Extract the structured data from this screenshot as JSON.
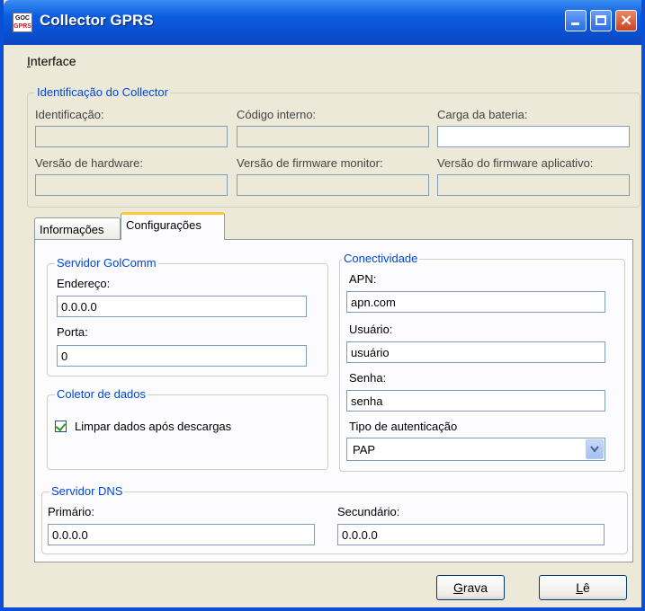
{
  "window": {
    "title": "Collector GPRS",
    "icon_text_top": "GOC",
    "icon_text_bottom": "GPRS",
    "controls": [
      "minimize-icon",
      "maximize-icon",
      "close-icon"
    ]
  },
  "menu": {
    "items": [
      {
        "first": "I",
        "rest": "nterface"
      }
    ]
  },
  "collector_group": {
    "legend": "Identificação do Collector",
    "fields": [
      {
        "label": "Identificação:",
        "value": ""
      },
      {
        "label": "Código interno:",
        "value": ""
      },
      {
        "label": "Carga da bateria:",
        "value": ""
      },
      {
        "label": "Versão de hardware:",
        "value": ""
      },
      {
        "label": "Versão de firmware monitor:",
        "value": ""
      },
      {
        "label": "Versão do firmware aplicativo:",
        "value": ""
      }
    ]
  },
  "tabs": {
    "items": [
      "Informações",
      "Configurações"
    ],
    "active": "Configurações"
  },
  "servidor_golcomm": {
    "legend": "Servidor GolComm",
    "endereco_label": "Endereço:",
    "endereco_value": "0.0.0.0",
    "porta_label": "Porta:",
    "porta_value": "0"
  },
  "coletor_de_dados": {
    "legend": "Coletor de dados",
    "checkbox_label": "Limpar dados após descargas",
    "checked": true
  },
  "conectividade": {
    "legend": "Conectividade",
    "apn_label": "APN:",
    "apn_value": "apn.com",
    "usuario_label": "Usuário:",
    "usuario_value": "usuário",
    "senha_label": "Senha:",
    "senha_value": "senha",
    "auth_label": "Tipo de autenticação",
    "auth_value": "PAP"
  },
  "servidor_dns": {
    "legend": "Servidor DNS",
    "primario_label": "Primário:",
    "primario_value": "0.0.0.0",
    "secundario_label": "Secundário:",
    "secundario_value": "0.0.0.0"
  },
  "buttons": {
    "grava": {
      "first": "G",
      "rest": "rava"
    },
    "le": {
      "first": "L",
      "rest": "ê"
    }
  },
  "colors": {
    "title_bar": "#0a50d0",
    "group_legend": "#0046d5",
    "window_bg": "#ece9d8",
    "tab_highlight": "#ffc83c",
    "check_mark": "#21a121"
  }
}
